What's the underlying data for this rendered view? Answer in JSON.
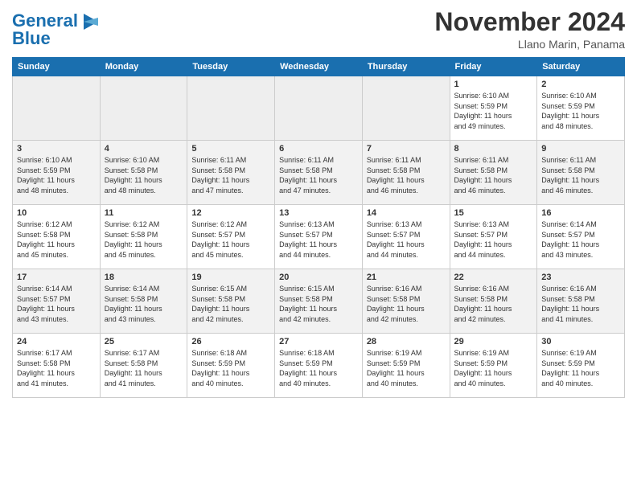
{
  "header": {
    "logo_line1": "General",
    "logo_line2": "Blue",
    "month_title": "November 2024",
    "location": "Llano Marin, Panama"
  },
  "weekdays": [
    "Sunday",
    "Monday",
    "Tuesday",
    "Wednesday",
    "Thursday",
    "Friday",
    "Saturday"
  ],
  "weeks": [
    [
      {
        "day": "",
        "info": ""
      },
      {
        "day": "",
        "info": ""
      },
      {
        "day": "",
        "info": ""
      },
      {
        "day": "",
        "info": ""
      },
      {
        "day": "",
        "info": ""
      },
      {
        "day": "1",
        "info": "Sunrise: 6:10 AM\nSunset: 5:59 PM\nDaylight: 11 hours\nand 49 minutes."
      },
      {
        "day": "2",
        "info": "Sunrise: 6:10 AM\nSunset: 5:59 PM\nDaylight: 11 hours\nand 48 minutes."
      }
    ],
    [
      {
        "day": "3",
        "info": "Sunrise: 6:10 AM\nSunset: 5:59 PM\nDaylight: 11 hours\nand 48 minutes."
      },
      {
        "day": "4",
        "info": "Sunrise: 6:10 AM\nSunset: 5:58 PM\nDaylight: 11 hours\nand 48 minutes."
      },
      {
        "day": "5",
        "info": "Sunrise: 6:11 AM\nSunset: 5:58 PM\nDaylight: 11 hours\nand 47 minutes."
      },
      {
        "day": "6",
        "info": "Sunrise: 6:11 AM\nSunset: 5:58 PM\nDaylight: 11 hours\nand 47 minutes."
      },
      {
        "day": "7",
        "info": "Sunrise: 6:11 AM\nSunset: 5:58 PM\nDaylight: 11 hours\nand 46 minutes."
      },
      {
        "day": "8",
        "info": "Sunrise: 6:11 AM\nSunset: 5:58 PM\nDaylight: 11 hours\nand 46 minutes."
      },
      {
        "day": "9",
        "info": "Sunrise: 6:11 AM\nSunset: 5:58 PM\nDaylight: 11 hours\nand 46 minutes."
      }
    ],
    [
      {
        "day": "10",
        "info": "Sunrise: 6:12 AM\nSunset: 5:58 PM\nDaylight: 11 hours\nand 45 minutes."
      },
      {
        "day": "11",
        "info": "Sunrise: 6:12 AM\nSunset: 5:58 PM\nDaylight: 11 hours\nand 45 minutes."
      },
      {
        "day": "12",
        "info": "Sunrise: 6:12 AM\nSunset: 5:57 PM\nDaylight: 11 hours\nand 45 minutes."
      },
      {
        "day": "13",
        "info": "Sunrise: 6:13 AM\nSunset: 5:57 PM\nDaylight: 11 hours\nand 44 minutes."
      },
      {
        "day": "14",
        "info": "Sunrise: 6:13 AM\nSunset: 5:57 PM\nDaylight: 11 hours\nand 44 minutes."
      },
      {
        "day": "15",
        "info": "Sunrise: 6:13 AM\nSunset: 5:57 PM\nDaylight: 11 hours\nand 44 minutes."
      },
      {
        "day": "16",
        "info": "Sunrise: 6:14 AM\nSunset: 5:57 PM\nDaylight: 11 hours\nand 43 minutes."
      }
    ],
    [
      {
        "day": "17",
        "info": "Sunrise: 6:14 AM\nSunset: 5:57 PM\nDaylight: 11 hours\nand 43 minutes."
      },
      {
        "day": "18",
        "info": "Sunrise: 6:14 AM\nSunset: 5:58 PM\nDaylight: 11 hours\nand 43 minutes."
      },
      {
        "day": "19",
        "info": "Sunrise: 6:15 AM\nSunset: 5:58 PM\nDaylight: 11 hours\nand 42 minutes."
      },
      {
        "day": "20",
        "info": "Sunrise: 6:15 AM\nSunset: 5:58 PM\nDaylight: 11 hours\nand 42 minutes."
      },
      {
        "day": "21",
        "info": "Sunrise: 6:16 AM\nSunset: 5:58 PM\nDaylight: 11 hours\nand 42 minutes."
      },
      {
        "day": "22",
        "info": "Sunrise: 6:16 AM\nSunset: 5:58 PM\nDaylight: 11 hours\nand 42 minutes."
      },
      {
        "day": "23",
        "info": "Sunrise: 6:16 AM\nSunset: 5:58 PM\nDaylight: 11 hours\nand 41 minutes."
      }
    ],
    [
      {
        "day": "24",
        "info": "Sunrise: 6:17 AM\nSunset: 5:58 PM\nDaylight: 11 hours\nand 41 minutes."
      },
      {
        "day": "25",
        "info": "Sunrise: 6:17 AM\nSunset: 5:58 PM\nDaylight: 11 hours\nand 41 minutes."
      },
      {
        "day": "26",
        "info": "Sunrise: 6:18 AM\nSunset: 5:59 PM\nDaylight: 11 hours\nand 40 minutes."
      },
      {
        "day": "27",
        "info": "Sunrise: 6:18 AM\nSunset: 5:59 PM\nDaylight: 11 hours\nand 40 minutes."
      },
      {
        "day": "28",
        "info": "Sunrise: 6:19 AM\nSunset: 5:59 PM\nDaylight: 11 hours\nand 40 minutes."
      },
      {
        "day": "29",
        "info": "Sunrise: 6:19 AM\nSunset: 5:59 PM\nDaylight: 11 hours\nand 40 minutes."
      },
      {
        "day": "30",
        "info": "Sunrise: 6:19 AM\nSunset: 5:59 PM\nDaylight: 11 hours\nand 40 minutes."
      }
    ]
  ]
}
